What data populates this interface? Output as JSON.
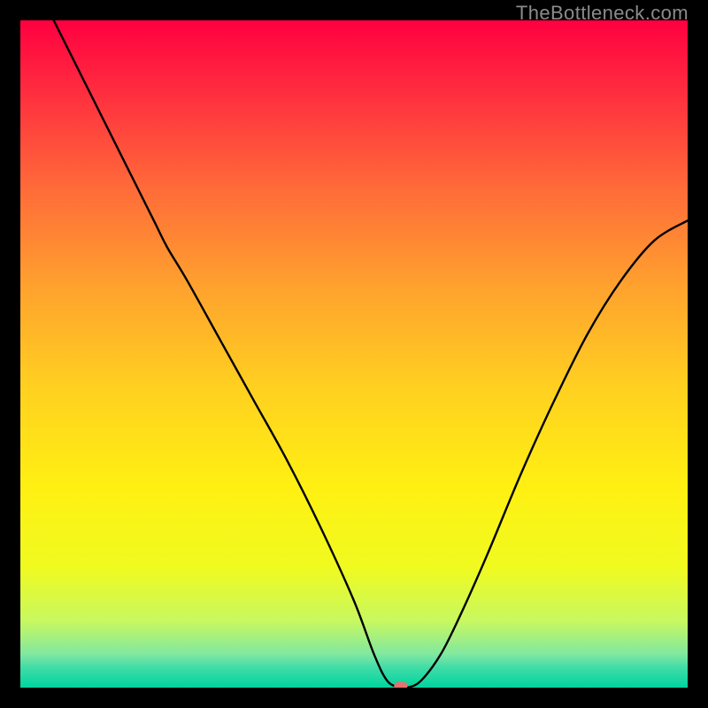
{
  "watermark": "TheBottleneck.com",
  "chart_data": {
    "type": "line",
    "title": "",
    "xlabel": "",
    "ylabel": "",
    "xlim": [
      0,
      100
    ],
    "ylim": [
      0,
      100
    ],
    "grid": false,
    "legend": false,
    "background_gradient": {
      "stops": [
        {
          "offset": 0.0,
          "color": "#ff0040"
        },
        {
          "offset": 0.1,
          "color": "#ff2a3f"
        },
        {
          "offset": 0.25,
          "color": "#ff6a39"
        },
        {
          "offset": 0.4,
          "color": "#ffa22e"
        },
        {
          "offset": 0.55,
          "color": "#ffd020"
        },
        {
          "offset": 0.7,
          "color": "#fff012"
        },
        {
          "offset": 0.82,
          "color": "#f0fa20"
        },
        {
          "offset": 0.9,
          "color": "#c8f860"
        },
        {
          "offset": 0.95,
          "color": "#80e8a0"
        },
        {
          "offset": 0.97,
          "color": "#40dca8"
        },
        {
          "offset": 1.0,
          "color": "#00d49e"
        }
      ]
    },
    "series": [
      {
        "name": "bottleneck-curve",
        "color": "#000000",
        "x": [
          5,
          10,
          15,
          20,
          22,
          25,
          30,
          35,
          40,
          45,
          50,
          53,
          55,
          57,
          58,
          60,
          63,
          66,
          70,
          75,
          80,
          85,
          90,
          95,
          100
        ],
        "y": [
          100,
          90,
          80,
          70,
          66,
          61,
          52,
          43,
          34,
          24,
          13,
          5,
          1,
          0,
          0,
          1,
          5,
          11,
          20,
          32,
          43,
          53,
          61,
          67,
          70
        ]
      }
    ],
    "marker": {
      "name": "optimal-point",
      "x": 57,
      "y": 0,
      "color": "#e87070",
      "shape": "capsule"
    }
  }
}
